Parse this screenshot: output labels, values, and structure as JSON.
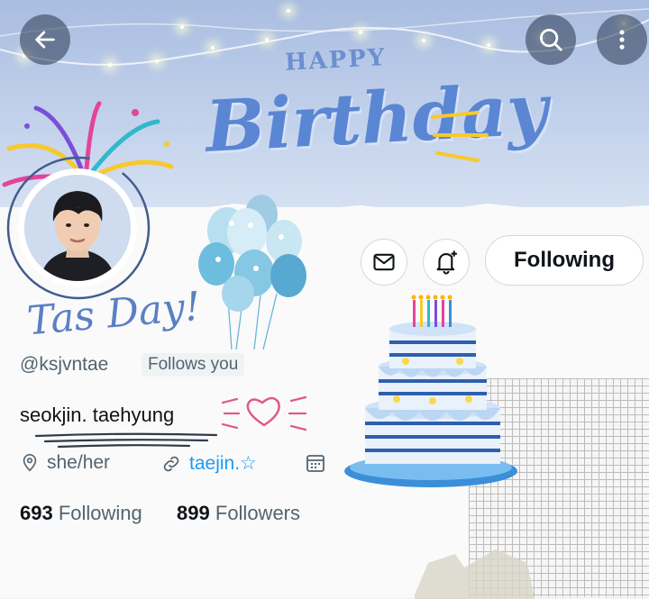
{
  "banner": {
    "happy": "HAPPY",
    "birthday": "Birthday"
  },
  "nav": {
    "back_icon": "arrow-left-icon",
    "search_icon": "search-icon",
    "more_icon": "more-vertical-icon"
  },
  "profile": {
    "overlay_text": "Tas Day!",
    "handle": "@ksjvntae",
    "follows_you": "Follows you",
    "display_name": "seokjin. taehyung",
    "pronouns": "she/her",
    "link": "taejin.☆",
    "following_count": "693",
    "following_label": "Following",
    "followers_count": "899",
    "followers_label": "Followers"
  },
  "actions": {
    "message_icon": "mail-icon",
    "notify_icon": "bell-plus-icon",
    "follow_label": "Following"
  },
  "colors": {
    "banner": "#b8c9e8",
    "accent": "#5a86d4",
    "link": "#1d9bf0",
    "muted": "#536471"
  }
}
